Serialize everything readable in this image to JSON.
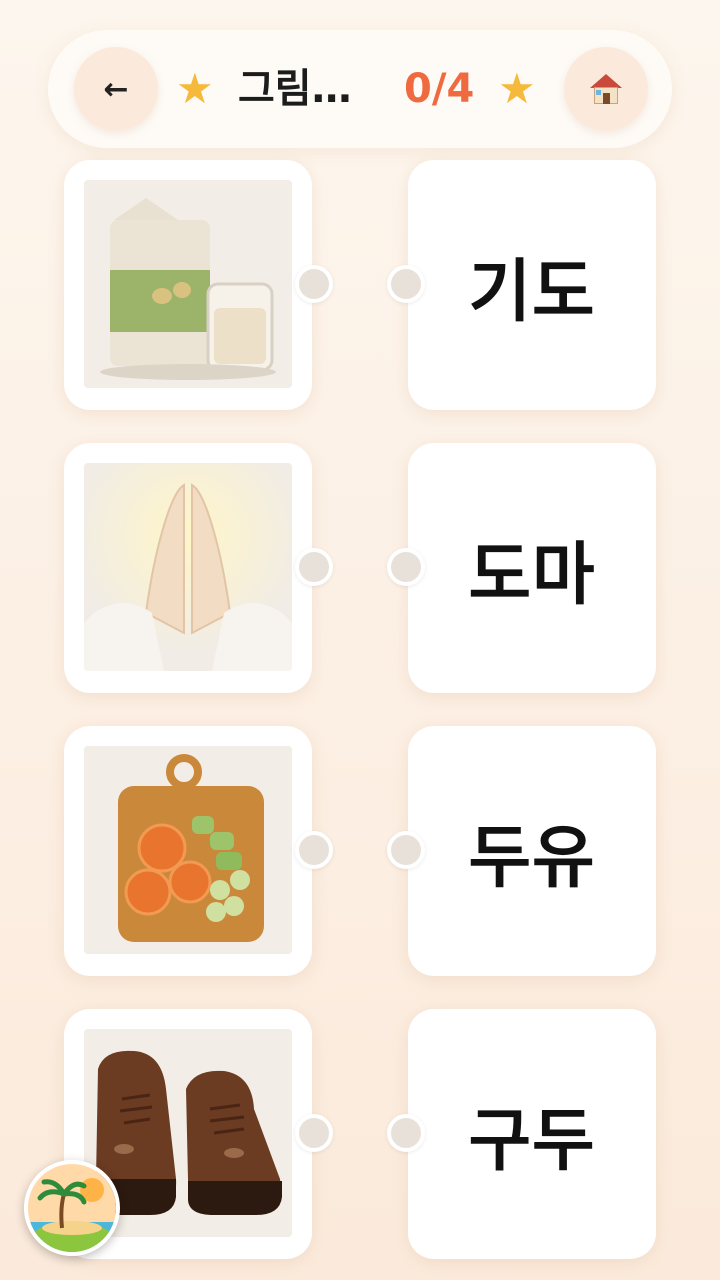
{
  "header": {
    "back_icon": "arrow-left-icon",
    "home_icon": "house-icon",
    "title": "그림…",
    "score": "0/4"
  },
  "pictures": [
    {
      "name": "soy-milk-picture"
    },
    {
      "name": "praying-hands-picture"
    },
    {
      "name": "cutting-board-picture"
    },
    {
      "name": "shoes-picture"
    }
  ],
  "words": [
    "기도",
    "도마",
    "두유",
    "구두"
  ],
  "colors": {
    "score": "#ef6a3e",
    "star": "#f5b93b",
    "card": "#ffffff"
  }
}
